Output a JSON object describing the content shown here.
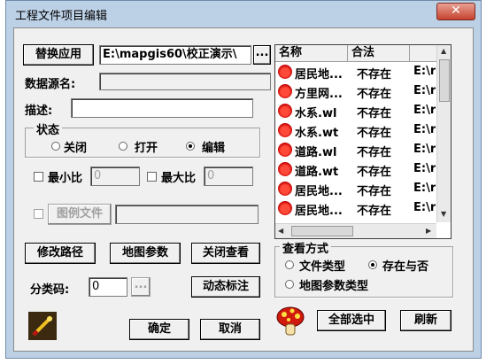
{
  "window": {
    "title": "工程文件项目编辑",
    "close_glyph": "✕"
  },
  "replace_button": "替换应用",
  "path_field": "E:\\mapgis60\\校正演示\\",
  "browse_button": "...",
  "datasource_label": "数据源名:",
  "description_label": "描述:",
  "state_group": {
    "title": "状态",
    "close": "关闭",
    "open": "打开",
    "edit": "编辑",
    "selected": "edit"
  },
  "min_scale_label": "最小比",
  "min_scale_value": "0",
  "max_scale_label": "最大比",
  "max_scale_value": "0",
  "legend_file_button": "图例文件",
  "list": {
    "columns": [
      "名称",
      "合法",
      ""
    ],
    "rows": [
      {
        "name": "居民地...",
        "status": "不存在",
        "path": "E:\\r"
      },
      {
        "name": "方里网...",
        "status": "不存在",
        "path": "E:\\r"
      },
      {
        "name": "水系.wl",
        "status": "不存在",
        "path": "E:\\r"
      },
      {
        "name": "水系.wt",
        "status": "不存在",
        "path": "E:\\r"
      },
      {
        "name": "道路.wl",
        "status": "不存在",
        "path": "E:\\r"
      },
      {
        "name": "道路.wt",
        "status": "不存在",
        "path": "E:\\r"
      },
      {
        "name": "居民地...",
        "status": "不存在",
        "path": "E:\\r"
      },
      {
        "name": "居民地...",
        "status": "不存在",
        "path": "E:\\r"
      }
    ]
  },
  "buttons": {
    "modify_path": "修改路径",
    "map_params": "地图参数",
    "close_view": "关闭查看",
    "dynamic_label": "动态标注",
    "ok": "确定",
    "cancel": "取消",
    "select_all": "全部选中",
    "refresh": "刷新"
  },
  "classify_label": "分类码:",
  "classify_value": "0",
  "view_group": {
    "title": "查看方式",
    "file_type": "文件类型",
    "exists_legal": "存在与否",
    "map_param_type": "地图参数类型",
    "selected": "exists_legal"
  },
  "colors": {
    "title_bar": "#bcd0e6",
    "close": "#c5432f",
    "mushroom": "#d11a0e"
  },
  "icons": {
    "pen": "pen-icon",
    "mushroom": "mushroom-icon"
  }
}
